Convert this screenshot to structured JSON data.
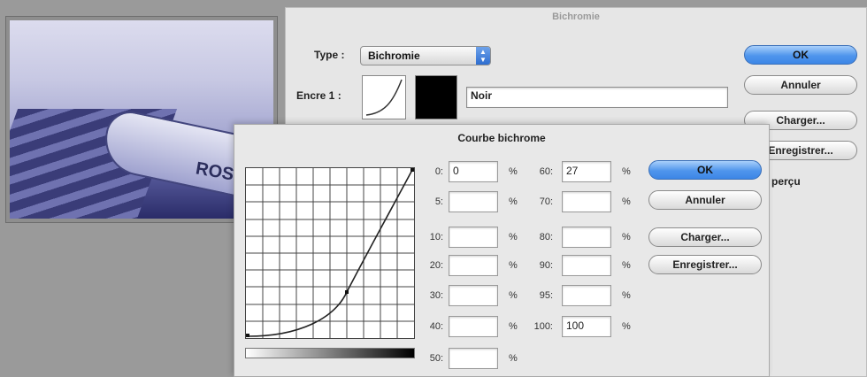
{
  "background_dialog": {
    "title": "Bichromie",
    "type_label": "Type :",
    "type_value": "Bichromie",
    "ink_label": "Encre 1 :",
    "ink_name": "Noir",
    "buttons": {
      "ok": "OK",
      "cancel": "Annuler",
      "load": "Charger...",
      "save": "Enregistrer..."
    },
    "preview_label": "perçu"
  },
  "photo": {
    "boat_text": "ROS"
  },
  "curve_dialog": {
    "title": "Courbe bichrome",
    "percent_sign": "%",
    "left_column": [
      {
        "label": "0:",
        "value": "0"
      },
      {
        "label": "5:",
        "value": ""
      },
      {
        "label": "10:",
        "value": ""
      },
      {
        "label": "20:",
        "value": ""
      },
      {
        "label": "30:",
        "value": ""
      },
      {
        "label": "40:",
        "value": ""
      },
      {
        "label": "50:",
        "value": ""
      }
    ],
    "right_column": [
      {
        "label": "60:",
        "value": "27"
      },
      {
        "label": "70:",
        "value": ""
      },
      {
        "label": "80:",
        "value": ""
      },
      {
        "label": "90:",
        "value": ""
      },
      {
        "label": "95:",
        "value": ""
      },
      {
        "label": "100:",
        "value": "100"
      }
    ],
    "buttons": {
      "ok": "OK",
      "cancel": "Annuler",
      "load": "Charger...",
      "save": "Enregistrer..."
    }
  },
  "colors": {
    "accent": "#4f95ec",
    "ink": "#000000"
  }
}
